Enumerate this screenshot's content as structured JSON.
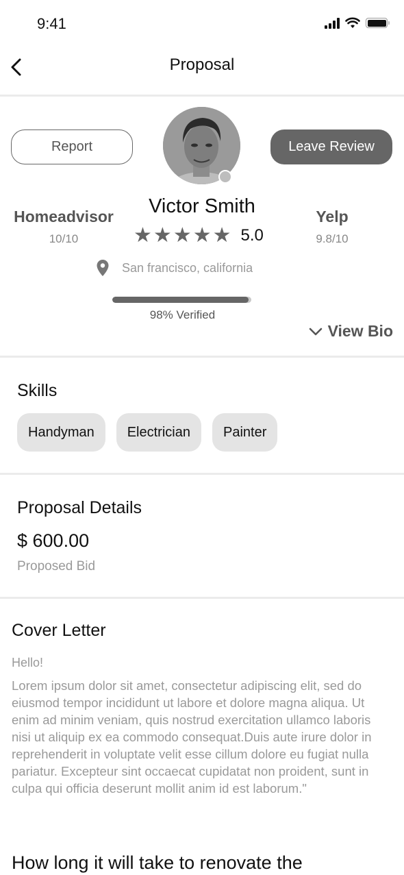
{
  "status_bar": {
    "time": "9:41",
    "icons": [
      "signal-icon",
      "wifi-icon",
      "battery-icon"
    ]
  },
  "nav": {
    "back_icon": "chevron-left-icon",
    "title": "Proposal"
  },
  "profile": {
    "report_label": "Report",
    "leave_review_label": "Leave Review",
    "name": "Victor Smith",
    "rating": {
      "stars_filled": 5,
      "stars_total": 5,
      "value": "5.0"
    },
    "online_status": "offline",
    "scores": [
      {
        "source": "Homeadvisor",
        "value": "10/10"
      },
      {
        "source": "Yelp",
        "value": "9.8/10"
      }
    ],
    "location": {
      "icon": "map-pin-icon",
      "text": "San francisco, california"
    },
    "verification": {
      "percent": 98,
      "label": "98% Verified"
    },
    "view_bio_label": "View Bio"
  },
  "skills": {
    "title": "Skills",
    "items": [
      "Handyman",
      "Electrician",
      "Painter"
    ]
  },
  "proposal_details": {
    "title": "Proposal Details",
    "amount": "$ 600.00",
    "amount_label": "Proposed Bid"
  },
  "cover_letter": {
    "title": "Cover Letter",
    "greeting": "Hello!",
    "body": "Lorem ipsum dolor sit amet, consectetur adipiscing elit, sed do eiusmod tempor incididunt ut labore et dolore magna aliqua. Ut enim ad minim veniam, quis nostrud exercitation ullamco laboris nisi ut aliquip ex ea commodo consequat.Duis aute irure dolor in reprehenderit in voluptate velit esse cillum dolore eu fugiat nulla pariatur. Excepteur sint occaecat cupidatat non proident, sunt in culpa qui officia deserunt mollit anim id est laborum.\""
  },
  "next_question": {
    "title": "How long it will take to renovate the"
  },
  "colors": {
    "primary_dark": "#666666",
    "chip_bg": "#e4e4e4",
    "divider": "#ebebeb",
    "muted_text": "#999999"
  }
}
